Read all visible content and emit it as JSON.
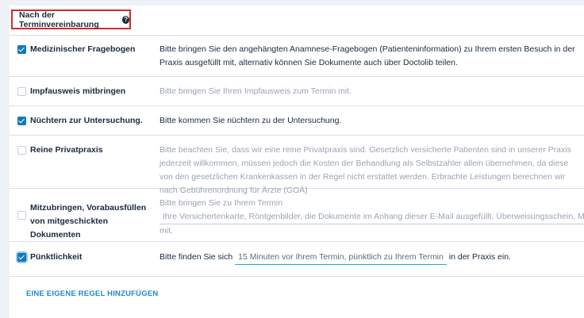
{
  "section": {
    "title": "Nach der Terminvereinbarung",
    "help_icon": "?"
  },
  "rules": [
    {
      "checked": true,
      "title": "Medizinischer Fragebogen",
      "description": "Bitte bringen Sie den angehängten Anamnese-Fragebogen (Patienteninformation) zu Ihrem ersten Besuch in der Praxis ausgefüllt mit, alternativ können Sie Dokumente auch über Doctolib teilen."
    },
    {
      "checked": false,
      "title": "Impfausweis mitbringen",
      "description": "Bitte bringen Sie Ihren Impfausweis zum Termin mit."
    },
    {
      "checked": true,
      "title": "Nüchtern zur Untersuchung.",
      "description": "Bitte kommen Sie nüchtern zu der Untersuchung."
    },
    {
      "checked": false,
      "title": "Reine Privatpraxis",
      "description": "Bitte beachten Sie, dass wir eine reine Privatpraxis sind. Gesetzlich versicherte Patienten sind in unserer Praxis jederzeit willkommen, müssen jedoch die Kosten der Behandlung als Selbstzahler allein übernehmen, da diese von den gesetzlichen Krankenkassen in der Regel nicht erstattet werden. Erbrachte Leistungen berechnen wir nach Gebührenordnung für Ärzte (GOÄ)"
    },
    {
      "checked": false,
      "title": "Mitzubringen, Vorabausfüllen von mitgeschickten Dokumenten",
      "description_prefix": "Bitte bringen Sie zu Ihrem Termin",
      "field_value": "Ihre Versichertenkarte, Röntgenbilder, die Dokumente im Anhang dieser E-Mail ausgefüllt, Überweisungsschein, Medikamentenliste",
      "description_suffix": "mit."
    },
    {
      "checked": true,
      "title": "Pünktlichkeit",
      "description_prefix": "Bitte finden Sie sich",
      "field_value": "15 Minuten vor Ihrem Termin, pünktlich zu Ihrem Termin",
      "description_suffix": "in der Praxis ein."
    }
  ],
  "add_rule_label": "EINE EIGENE REGEL HINZUFÜGEN",
  "colors": {
    "accent": "#107ac1",
    "link": "#1a8bd1",
    "highlight_border": "#d42a2a"
  }
}
